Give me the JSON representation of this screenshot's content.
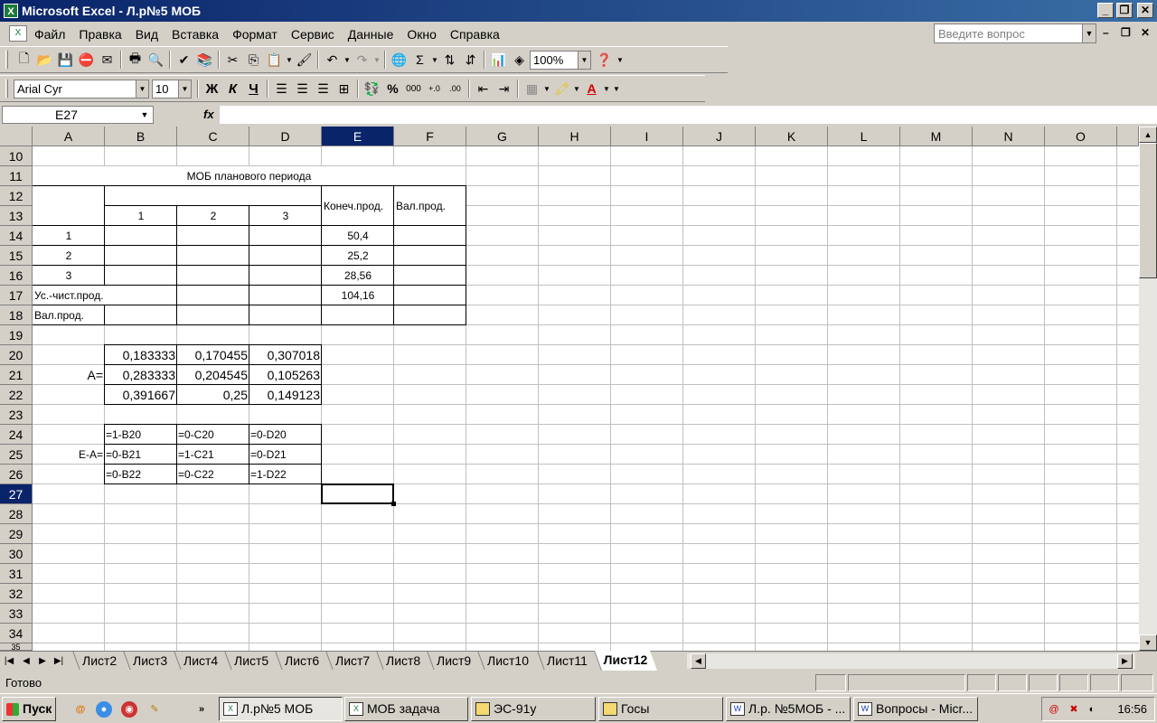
{
  "window": {
    "title": "Microsoft Excel - Л.р№5 МОБ"
  },
  "menu": [
    "Файл",
    "Правка",
    "Вид",
    "Вставка",
    "Формат",
    "Сервис",
    "Данные",
    "Окно",
    "Справка"
  ],
  "help_placeholder": "Введите вопрос",
  "toolbar": {
    "zoom": "100%"
  },
  "format_toolbar": {
    "font": "Arial Cyr",
    "size": "10",
    "bold": "Ж",
    "italic": "К",
    "underline": "Ч"
  },
  "formula_bar": {
    "name_box": "E27",
    "fx": "fx",
    "formula": ""
  },
  "columns": [
    "A",
    "B",
    "C",
    "D",
    "E",
    "F",
    "G",
    "H",
    "I",
    "J",
    "K",
    "L",
    "M",
    "N",
    "O"
  ],
  "rows": [
    "10",
    "11",
    "12",
    "13",
    "14",
    "15",
    "16",
    "17",
    "18",
    "19",
    "20",
    "21",
    "22",
    "23",
    "24",
    "25",
    "26",
    "27",
    "28",
    "29",
    "30",
    "31",
    "32",
    "33",
    "34",
    "35"
  ],
  "selected_cell": {
    "col": "E",
    "row": "27"
  },
  "sheet": {
    "title": "МОБ планового периода",
    "sector_headers": [
      "1",
      "2",
      "3"
    ],
    "final_product_header": "Конеч.прод.",
    "gross_product_header": "Вал.прод.",
    "row_labels": [
      "1",
      "2",
      "3"
    ],
    "net_product_label": "Ус.-чист.прод.",
    "gross_label": "Вал.прод.",
    "final_product": [
      "50,4",
      "25,2",
      "28,56",
      "104,16"
    ],
    "matrix_a_label": "A=",
    "matrix_a": [
      [
        "0,183333",
        "0,170455",
        "0,307018"
      ],
      [
        "0,283333",
        "0,204545",
        "0,105263"
      ],
      [
        "0,391667",
        "0,25",
        "0,149123"
      ]
    ],
    "matrix_ea_label": "E-A=",
    "matrix_ea": [
      [
        "=1-B20",
        "=0-C20",
        "=0-D20"
      ],
      [
        "=0-B21",
        "=1-C21",
        "=0-D21"
      ],
      [
        "=0-B22",
        "=0-C22",
        "=1-D22"
      ]
    ]
  },
  "sheet_tabs": [
    "Лист2",
    "Лист3",
    "Лист4",
    "Лист5",
    "Лист6",
    "Лист7",
    "Лист8",
    "Лист9",
    "Лист10",
    "Лист11",
    "Лист12"
  ],
  "active_tab": "Лист12",
  "status": "Готово",
  "taskbar": {
    "start": "Пуск",
    "tasks": [
      "Л.р№5 МОБ",
      "МОБ задача",
      "ЭС-91у",
      "Госы",
      "Л.р. №5МОБ - ...",
      "Вопросы - Micr..."
    ],
    "clock": "16:56"
  }
}
